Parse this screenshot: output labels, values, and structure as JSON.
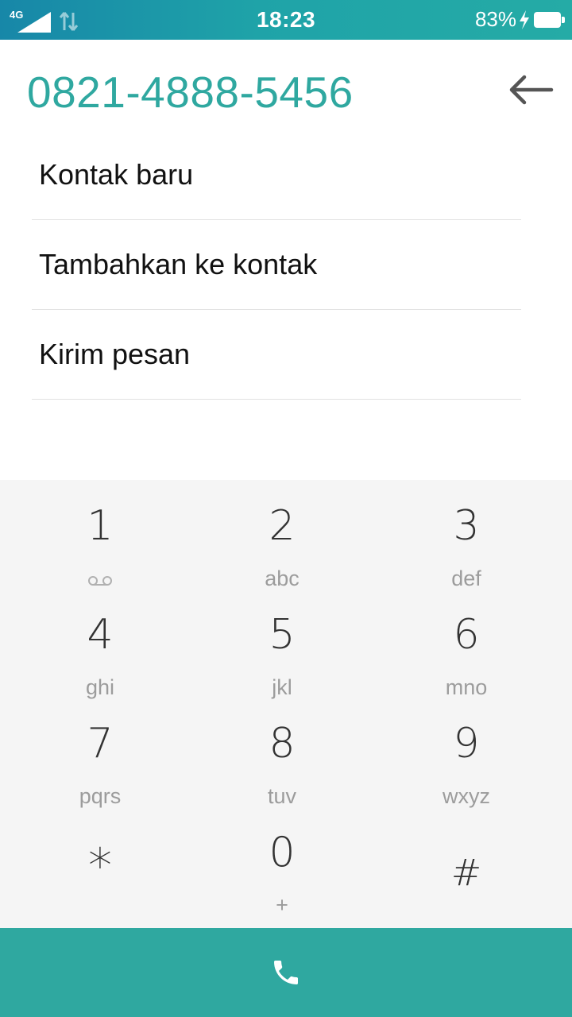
{
  "status_bar": {
    "network": "4G",
    "time": "18:23",
    "battery": "83%"
  },
  "header": {
    "phone_number": "0821-4888-5456"
  },
  "menu": [
    {
      "label": "Kontak baru"
    },
    {
      "label": "Tambahkan ke kontak"
    },
    {
      "label": "Kirim pesan"
    }
  ],
  "dialpad": {
    "keys": [
      {
        "digit": "1",
        "letters": "",
        "icon": "voicemail-icon"
      },
      {
        "digit": "2",
        "letters": "abc"
      },
      {
        "digit": "3",
        "letters": "def"
      },
      {
        "digit": "4",
        "letters": "ghi"
      },
      {
        "digit": "5",
        "letters": "jkl"
      },
      {
        "digit": "6",
        "letters": "mno"
      },
      {
        "digit": "7",
        "letters": "pqrs"
      },
      {
        "digit": "8",
        "letters": "tuv"
      },
      {
        "digit": "9",
        "letters": "wxyz"
      },
      {
        "digit": "*",
        "letters": ""
      },
      {
        "digit": "0",
        "letters": "+"
      },
      {
        "digit": "#",
        "letters": ""
      }
    ]
  },
  "colors": {
    "accent": "#2fa8a0",
    "dialpad_bg": "#f5f5f5",
    "status_bar_start": "#1787a8",
    "status_bar_end": "#25aba6"
  },
  "icons": {
    "back": "back-arrow-icon",
    "call": "phone-icon",
    "signal": "signal-icon",
    "data": "data-arrows-icon",
    "charging": "charging-bolt-icon",
    "battery": "battery-icon"
  }
}
